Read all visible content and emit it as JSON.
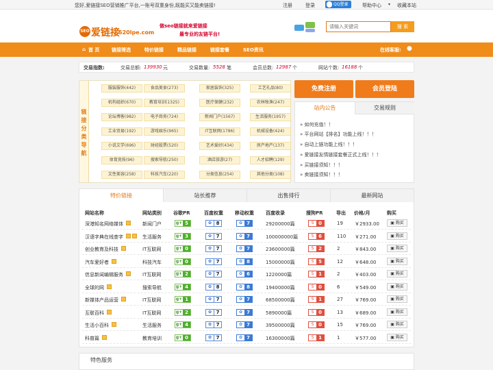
{
  "topbar": {
    "message": "您好,爱链接SEO营销推广平台,一账号双重身份,既能买又能卖链接!",
    "register": "注册",
    "login": "登录",
    "qq_login": "QQ登录",
    "help": "帮助中心",
    "bookmark": "收藏本站"
  },
  "header": {
    "logo_badge": "SEO",
    "logo_text": "爱链接",
    "logo_domain": "520lpe.com",
    "slogan1": "做seo链接就来爱链接",
    "slogan2": "最专业的友链平台!",
    "search_placeholder": "请输入关键词",
    "search_button": "搜 索"
  },
  "nav": {
    "items": [
      "首 页",
      "链接筛选",
      "特价链接",
      "精品链接",
      "链接套餐",
      "SEO资讯"
    ],
    "online_service": "在线客服:"
  },
  "stats": {
    "label": "交易指数:",
    "items": [
      {
        "label": "交易总额:",
        "value": "139930",
        "unit": "元"
      },
      {
        "label": "交易数量:",
        "value": "5528",
        "unit": "笔"
      },
      {
        "label": "会员总数:",
        "value": "12987",
        "unit": "个"
      },
      {
        "label": "网站个数:",
        "value": "16188",
        "unit": "个"
      }
    ]
  },
  "categories": {
    "side_title": [
      "链",
      "接",
      "分",
      "类",
      "导",
      "航"
    ],
    "items": [
      "服装服饰(442)",
      "食品美食(273)",
      "家居装饰(325)",
      "工艺礼品(80)",
      "机构组织(670)",
      "教育培训(1325)",
      "医疗保健(232)",
      "农林牧渔(247)",
      "论坛博客(982)",
      "电子商务(724)",
      "新闻门户(1567)",
      "生活服务(1957)",
      "工业贸易(192)",
      "游戏娱乐(965)",
      "IT互联网(1786)",
      "机械设备(424)",
      "小说文学(696)",
      "财经股票(520)",
      "艺术爱好(434)",
      "房产地产(137)",
      "体育竞技(96)",
      "搜索导航(250)",
      "酒店旅游(27)",
      "人才招聘(129)",
      "文性美容(258)",
      "科技汽车(220)",
      "分类信息(254)",
      "其他分类(108)"
    ]
  },
  "actions": {
    "register": "免费注册",
    "login": "会员登陆"
  },
  "notice": {
    "tab_active": "站内公告",
    "tab_other": "交易规则",
    "items": [
      "» 如何充值！！",
      "» 平台网站【排名】功能上线！！！",
      "» 自动上链功能上线！！！",
      "» 爱链接友情链接套餐正式上线！！！",
      "» 买链接须知！！！",
      "» 卖链接须知！！！"
    ]
  },
  "main": {
    "tabs": [
      "特价链接",
      "站长推荐",
      "出售排行",
      "最新网站"
    ],
    "headers": [
      "网站名称",
      "网站类别",
      "谷歌PR",
      "百度权重",
      "移动权重",
      "百度收录",
      "搜狗PR",
      "导出",
      "价格/月",
      "购买"
    ],
    "buy_label": "购买",
    "rows": [
      {
        "name": "深港知名网络媒体",
        "ticks": 1,
        "cat": "新闻门户",
        "pr": "5",
        "bd": "8",
        "mb": "7",
        "idx": "29200000篇",
        "sg": "0",
        "out": "19",
        "price": "￥2933.00"
      },
      {
        "name": "汉语字典在线查字",
        "ticks": 2,
        "cat": "生活服务",
        "pr": "3",
        "bd": "7",
        "mb": "7",
        "idx": "100000000篇",
        "sg": "6",
        "out": "110",
        "price": "￥271.00"
      },
      {
        "name": "创业教育及科技",
        "ticks": 1,
        "cat": "IT互联网",
        "pr": "0",
        "bd": "7",
        "mb": "7",
        "idx": "23600000篇",
        "sg": "2",
        "out": "2",
        "price": "￥843.00"
      },
      {
        "name": "汽车爱好者",
        "ticks": 1,
        "cat": "科技汽车",
        "pr": "0",
        "bd": "7",
        "mb": "8",
        "idx": "15000000篇",
        "sg": "5",
        "out": "12",
        "price": "￥648.00"
      },
      {
        "name": "信息新闻编辑服务",
        "ticks": 1,
        "cat": "IT互联网",
        "pr": "2",
        "bd": "7",
        "mb": "6",
        "idx": "1220000篇",
        "sg": "1",
        "out": "2",
        "price": "￥403.00"
      },
      {
        "name": "全球的网",
        "ticks": 1,
        "cat": "搜索导航",
        "pr": "4",
        "bd": "8",
        "mb": "8",
        "idx": "19400000篇",
        "sg": "0",
        "out": "6",
        "price": "￥549.00"
      },
      {
        "name": "新媒体产品运营",
        "ticks": 1,
        "cat": "IT互联网",
        "pr": "1",
        "bd": "7",
        "mb": "7",
        "idx": "68500000篇",
        "sg": "1",
        "out": "27",
        "price": "￥769.00"
      },
      {
        "name": "互联百科",
        "ticks": 1,
        "cat": "IT互联网",
        "pr": "2",
        "bd": "7",
        "mb": "7",
        "idx": "5890000篇",
        "sg": "0",
        "out": "13",
        "price": "￥689.00"
      },
      {
        "name": "生活小百科",
        "ticks": 1,
        "cat": "生活服务",
        "pr": "4",
        "bd": "7",
        "mb": "7",
        "idx": "39500000篇",
        "sg": "0",
        "out": "15",
        "price": "￥769.00"
      },
      {
        "name": "科普篇",
        "ticks": 1,
        "cat": "教育培训",
        "pr": "0",
        "bd": "7",
        "mb": "7",
        "idx": "16300000篇",
        "sg": "1",
        "out": "1",
        "price": "￥577.00"
      }
    ]
  },
  "special": {
    "title": "特色服务"
  },
  "colors": {
    "accent": "#f08c1a",
    "highlight": "#d2002b",
    "google_green": "#4caf2c",
    "mobile_blue": "#3b7bd6",
    "sogou_red": "#e05040"
  }
}
